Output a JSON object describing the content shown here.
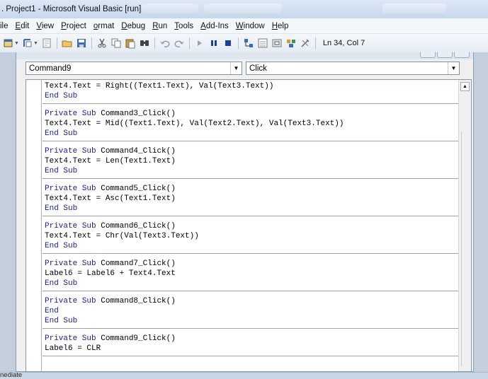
{
  "window": {
    "title": ". Project1 - Microsoft Visual Basic [run]"
  },
  "menu": [
    {
      "label": "ile",
      "accel": "",
      "rest": "ile"
    },
    {
      "label": "Edit",
      "accel": "E",
      "rest": "dit"
    },
    {
      "label": "View",
      "accel": "V",
      "rest": "iew"
    },
    {
      "label": "Project",
      "accel": "P",
      "rest": "roject"
    },
    {
      "label": "Format",
      "accel": "o",
      "rest": "rmat"
    },
    {
      "label": "Debug",
      "accel": "D",
      "rest": "ebug"
    },
    {
      "label": "Run",
      "accel": "R",
      "rest": "un"
    },
    {
      "label": "Tools",
      "accel": "T",
      "rest": "ools"
    },
    {
      "label": "Add-Ins",
      "accel": "A",
      "rest": "dd-Ins"
    },
    {
      "label": "Window",
      "accel": "W",
      "rest": "indow"
    },
    {
      "label": "Help",
      "accel": "H",
      "rest": "elp"
    }
  ],
  "toolbar": {
    "status": "Ln 34, Col 7"
  },
  "code_window": {
    "object_combo": "Command9",
    "procedure_combo": "Click"
  },
  "code_blocks": [
    [
      "Text4.Text = Right((Text1.Text), Val(Text3.Text))",
      "End Sub"
    ],
    [
      "Private Sub Command3_Click()",
      "Text4.Text = Mid((Text1.Text), Val(Text2.Text), Val(Text3.Text))",
      "End Sub"
    ],
    [
      "Private Sub Command4_Click()",
      "Text4.Text = Len(Text1.Text)",
      "End Sub"
    ],
    [
      "Private Sub Command5_Click()",
      "Text4.Text = Asc(Text1.Text)",
      "End Sub"
    ],
    [
      "Private Sub Command6_Click()",
      "Text4.Text = Chr(Val(Text3.Text))",
      "End Sub"
    ],
    [
      "Private Sub Command7_Click()",
      "Label6 = Label6 + Text4.Text",
      "End Sub"
    ],
    [
      "Private Sub Command8_Click()",
      "End",
      "End Sub"
    ],
    [
      "Private Sub Command9_Click()",
      "Label6 = CLR"
    ]
  ],
  "immediate": {
    "label": "nediate"
  },
  "colors": {
    "keyword": "#1a1aa6",
    "code_text": "#000000",
    "titlebar": "#c7d7ec"
  }
}
